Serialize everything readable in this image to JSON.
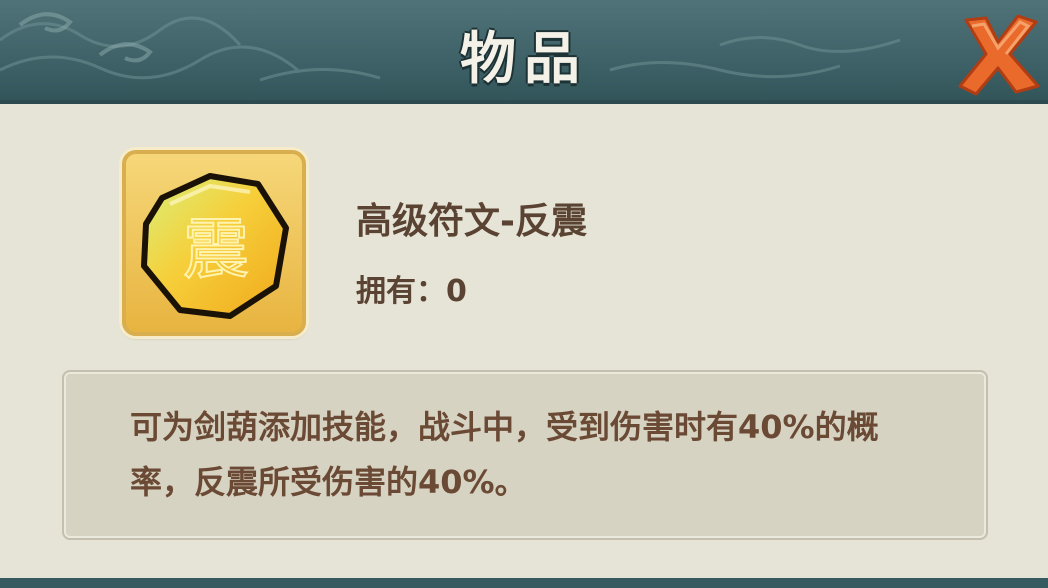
{
  "dialog": {
    "title": "物品",
    "close_icon": "close-x-icon"
  },
  "item": {
    "icon": "rune-stone-icon",
    "icon_glyph": "震",
    "name": "高级符文-反震",
    "owned_label": "拥有：",
    "owned_count": "0",
    "description": "可为剑葫添加技能，战斗中，受到伤害时有40%的概率，反震所受伤害的40%。"
  },
  "colors": {
    "header": "#3b5f64",
    "panel": "#e6e4d6",
    "text": "#5a4332",
    "close": "#e8642c",
    "rune": "#f2c531"
  }
}
